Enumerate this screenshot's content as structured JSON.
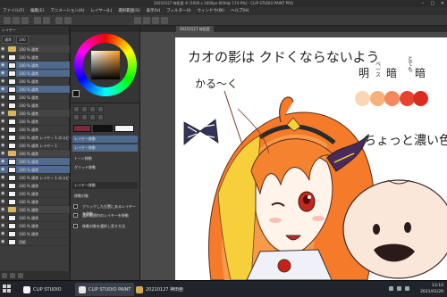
{
  "window": {
    "title": "20210127 神田亜 ※ [1000 x 1600px 600dpi 174.9%] - CLIP STUDIO PAINT PRO"
  },
  "menu": [
    "ファイル(F)",
    "編集(E)",
    "アニメーション(A)",
    "レイヤー(L)",
    "選択範囲(S)",
    "表示(V)",
    "フィルター(I)",
    "ウィンドウ(W)",
    "ヘルプ(H)"
  ],
  "layer_panel": {
    "header": "レイヤー",
    "blend_mode": "通常",
    "opacity": "100",
    "layers": [
      {
        "name": "100 % 通常",
        "type": "folder",
        "selected": false
      },
      {
        "name": "100 % 通常",
        "type": "layer",
        "selected": false
      },
      {
        "name": "100 % 通常",
        "type": "layer",
        "selected": true
      },
      {
        "name": "100 % 通常",
        "type": "layer",
        "selected": true
      },
      {
        "name": "100 % 通常",
        "type": "layer",
        "selected": false
      },
      {
        "name": "100 % 通常",
        "type": "layer",
        "selected": true
      },
      {
        "name": "100 % 通常",
        "type": "layer",
        "selected": false
      },
      {
        "name": "100 % 通常",
        "type": "layer",
        "selected": false
      },
      {
        "name": "100 % 通常",
        "type": "folder",
        "selected": false
      },
      {
        "name": "100 % 通常",
        "type": "layer",
        "selected": false
      },
      {
        "name": "100 % 通常",
        "type": "layer",
        "selected": false
      },
      {
        "name": "100 % 通常 レイヤー 1 のコピー",
        "type": "layer",
        "selected": false
      },
      {
        "name": "100 % 通常 レイヤー 1",
        "type": "layer",
        "selected": false
      },
      {
        "name": "100 % 通常",
        "type": "folder",
        "selected": false
      },
      {
        "name": "100 % 通常",
        "type": "layer",
        "selected": true
      },
      {
        "name": "100 % 通常",
        "type": "layer",
        "selected": true
      },
      {
        "name": "100 % 通常 レイヤー 1 のコピー",
        "type": "layer",
        "selected": false
      },
      {
        "name": "100 % 通常",
        "type": "layer",
        "selected": false
      },
      {
        "name": "100 % 通常",
        "type": "layer",
        "selected": false
      },
      {
        "name": "100 % 通常",
        "type": "layer",
        "selected": false
      },
      {
        "name": "100 % 通常",
        "type": "folder",
        "selected": false
      },
      {
        "name": "100 % 通常",
        "type": "layer",
        "selected": false
      },
      {
        "name": "100 % 通常",
        "type": "layer",
        "selected": false
      },
      {
        "name": "100 % 通常",
        "type": "layer",
        "selected": false
      },
      {
        "name": "用紙",
        "type": "layer",
        "selected": false
      }
    ]
  },
  "tool_panel": {
    "items": [
      {
        "label": "レイヤー移動",
        "style": "hl"
      },
      {
        "label": "レイヤー移動",
        "style": "hl"
      },
      {
        "label": "トーン移動",
        "style": "normal"
      },
      {
        "label": "グリッド移動",
        "style": "normal"
      },
      {
        "label": "レイヤー移動",
        "style": "dark"
      },
      {
        "label": "移動対象",
        "style": "normal"
      },
      {
        "label": "クリックした位置にあるレイヤーを移動",
        "style": "normal"
      },
      {
        "label": "選択範囲内のレイヤーを移動",
        "style": "normal"
      },
      {
        "label": "移動対象を選択し直す方法",
        "style": "normal"
      }
    ]
  },
  "canvas": {
    "tab_label": "20210127 神田亜",
    "note_line1": "カオの影は クドくならないよう",
    "note_line2": "かる〜く",
    "note_line3": "ちょっと濃い色",
    "col_bright": "明",
    "col_base": "ベース",
    "col_shadow": "暗",
    "col_deep_small": "とても",
    "col_deep": "暗",
    "swatches": [
      "#fbd5b4",
      "#f7b27c",
      "#f38a5d",
      "#e74430",
      "#d92d22"
    ]
  },
  "taskbar": {
    "items": [
      {
        "label": "CLIP STUDIO",
        "color": "#f5f5f5"
      },
      {
        "label": "CLIP STUDIO PAINT",
        "color": "#e8e8e8"
      },
      {
        "label": "20210127 神田亜",
        "color": "#d6a94a"
      }
    ],
    "time": "13:10",
    "date": "2021/01/29"
  },
  "colors": {
    "accent": "#4f6a8f",
    "app_bg": "#3c3c3c"
  }
}
